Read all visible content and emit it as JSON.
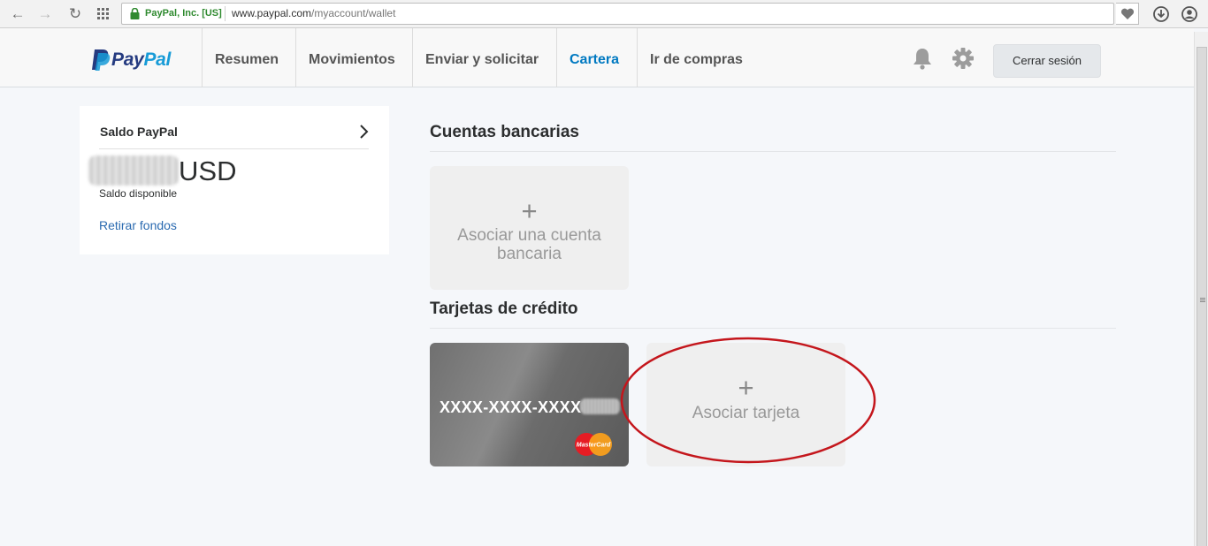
{
  "browser": {
    "secure_label": "PayPal, Inc. [US]",
    "url_host": "www.paypal.com",
    "url_path": "/myaccount/wallet"
  },
  "header": {
    "logo_pay": "Pay",
    "logo_pal": "Pal",
    "nav": {
      "summary": "Resumen",
      "activity": "Movimientos",
      "send_request": "Enviar y solicitar",
      "wallet": "Cartera",
      "shop": "Ir de compras"
    },
    "logout": "Cerrar sesión"
  },
  "balance": {
    "title": "Saldo PayPal",
    "currency": "USD",
    "subtitle": "Saldo disponible",
    "withdraw": "Retirar fondos"
  },
  "bank_accounts": {
    "title": "Cuentas bancarias",
    "add_plus": "+",
    "add_label": "Asociar una cuenta bancaria"
  },
  "credit_cards": {
    "title": "Tarjetas de crédito",
    "card_number": "XXXX-XXXX-XXXX-",
    "card_brand": "MasterCard",
    "add_plus": "+",
    "add_label": "Asociar tarjeta"
  },
  "colors": {
    "paypal_navy": "#253b80",
    "paypal_blue": "#179bd7",
    "active_nav": "#0079c1",
    "annotation_red": "#c4161c"
  }
}
